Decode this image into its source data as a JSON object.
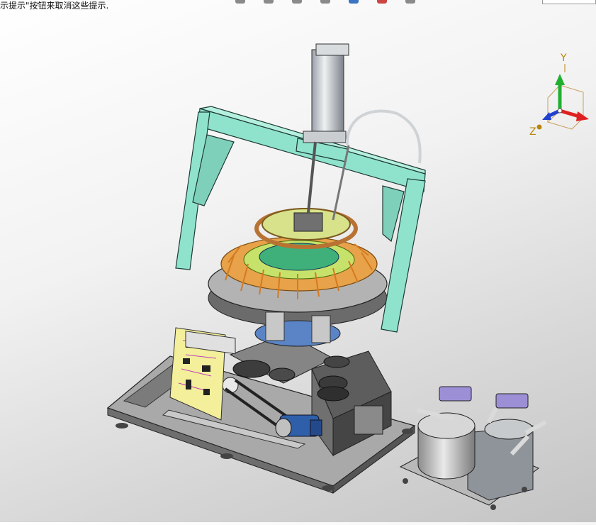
{
  "status": {
    "hint_text": "示提示\"按钮来取消这些提示."
  },
  "triad": {
    "y_label": "Y",
    "z_label": "Z",
    "colors": {
      "x": "#e02020",
      "y": "#20b030",
      "z": "#2040d0",
      "label": "#b8860b"
    }
  },
  "toolbar": {
    "buttons": [
      "view-orientation-icon",
      "display-style-icon",
      "section-view-icon",
      "hide-show-icon",
      "edit-appearance-icon",
      "scene-icon",
      "view-settings-icon"
    ]
  },
  "model": {
    "frame_color": "#8fe3cc",
    "base_color": "#6f6f6f",
    "table_color": "#a8a8a8",
    "pcb_color": "#f3ef9a",
    "motor_color": "#2f5fa8",
    "ring_color": "#e7a24a"
  }
}
